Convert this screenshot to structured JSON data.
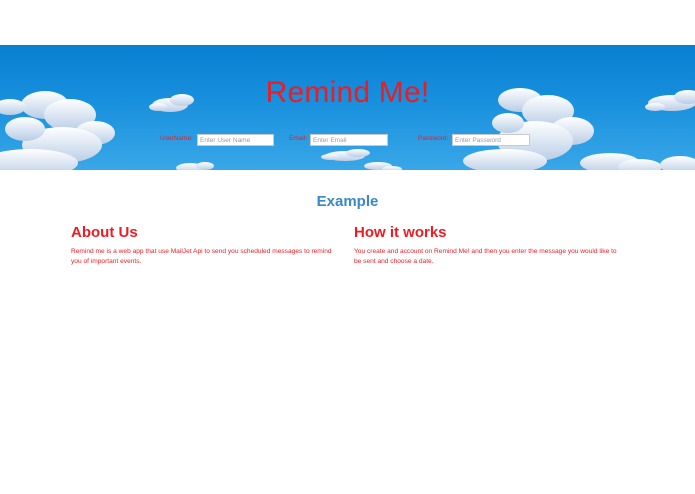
{
  "hero": {
    "title": "Remind Me!",
    "form": {
      "username_label": "UserName:",
      "username_placeholder": "Enter User Name",
      "email_label": "Email:",
      "email_placeholder": "Enter Email",
      "password_label": "Password:",
      "password_placeholder": "Enter Password"
    }
  },
  "main": {
    "example_heading": "Example",
    "about": {
      "heading": "About Us",
      "body": "Remind me is a web app that use MailJet Api to send you scheduled messages to remind you of important events."
    },
    "how": {
      "heading": "How it works",
      "body": "You create and account on Remind Me! and then you enter the message you would like to be sent and choose a date."
    }
  },
  "colors": {
    "accent_red": "#ec1c24",
    "heading_blue": "#3a87c9",
    "sky_top": "#0a7fd2",
    "sky_bottom": "#39a7e8"
  }
}
